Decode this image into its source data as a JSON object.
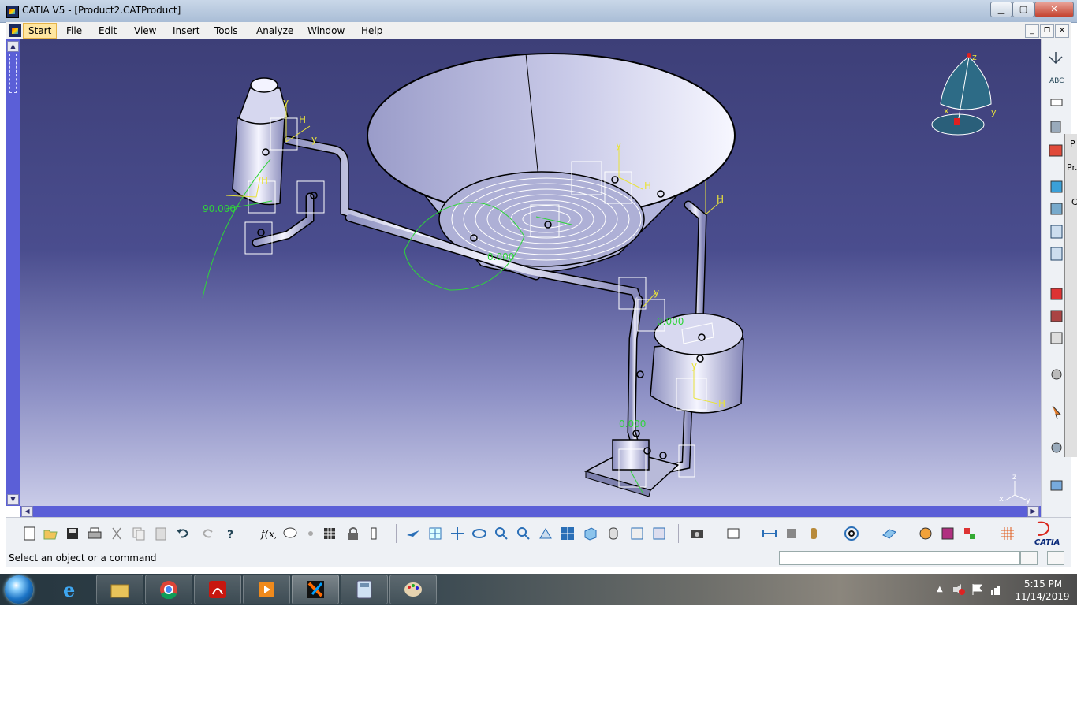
{
  "window": {
    "title": "CATIA V5 - [Product2.CATProduct]",
    "minimize_glyph": "▁",
    "maximize_glyph": "▢",
    "close_glyph": "✕"
  },
  "menu": {
    "items": [
      "Start",
      "File",
      "Edit",
      "View",
      "Insert",
      "Tools",
      "Analyze",
      "Window",
      "Help"
    ],
    "mdi_minimize": "_",
    "mdi_restore": "❐",
    "mdi_close": "✕"
  },
  "viewport": {
    "background_top": "#3d3f78",
    "background_bottom": "#c9cbe8",
    "annotations": {
      "angle_left": "90.000",
      "angle_bowl": "0.000",
      "angle_right": "0.000",
      "angle_pump": "0.000"
    },
    "compass_axes": {
      "z": "z",
      "x": "x",
      "y": "y"
    },
    "mini_axes": {
      "z": "z",
      "x": "x",
      "y": "y"
    },
    "frame_labels": {
      "y": "y",
      "h": "H"
    }
  },
  "side_panel": {
    "tab1": "P",
    "tab2": "Pr.",
    "tab3": "C"
  },
  "statusbar": {
    "message": "Select an object or a command",
    "command_value": ""
  },
  "bottom_toolbar": {
    "brand": "CATIA",
    "brand_color": "#d9261c",
    "icons": [
      "new-icon",
      "open-icon",
      "save-icon",
      "print-icon",
      "cut-icon",
      "copy-icon",
      "paste-icon",
      "undo-icon",
      "redo-icon",
      "whats-this-icon",
      "formula-icon",
      "comment-icon",
      "knowledge-icon",
      "table-icon",
      "lock-icon",
      "parameters-icon",
      "fly-mode-icon",
      "fit-all-icon",
      "pan-icon",
      "rotate-icon",
      "zoom-in-icon",
      "zoom-out-icon",
      "normal-view-icon",
      "multi-view-icon",
      "iso-view-icon",
      "shading-icon",
      "hide-show-icon",
      "swap-visible-icon",
      "capture-icon",
      "analysis-icon",
      "measure-icon",
      "clash-icon",
      "inertia-icon",
      "spiral-icon",
      "plane-icon",
      "render-icon",
      "material-icon",
      "apply-icon",
      "grid-icon"
    ]
  },
  "right_toolbar": {
    "icons": [
      "axis-icon",
      "text-icon",
      "flag-icon",
      "snap-icon",
      "paint-icon",
      "component-icon",
      "product-icon",
      "constraint-icon",
      "constraint-icon-2",
      "explode-icon",
      "sequence-icon",
      "table-icon",
      "gear-icon",
      "arrow-icon",
      "settings-icon",
      "link-icon"
    ]
  },
  "taskbar": {
    "apps": [
      "internet-explorer",
      "file-explorer",
      "chrome",
      "acrobat",
      "media-player",
      "catia",
      "calculator",
      "paint"
    ],
    "time": "5:15 PM",
    "date": "11/14/2019"
  }
}
